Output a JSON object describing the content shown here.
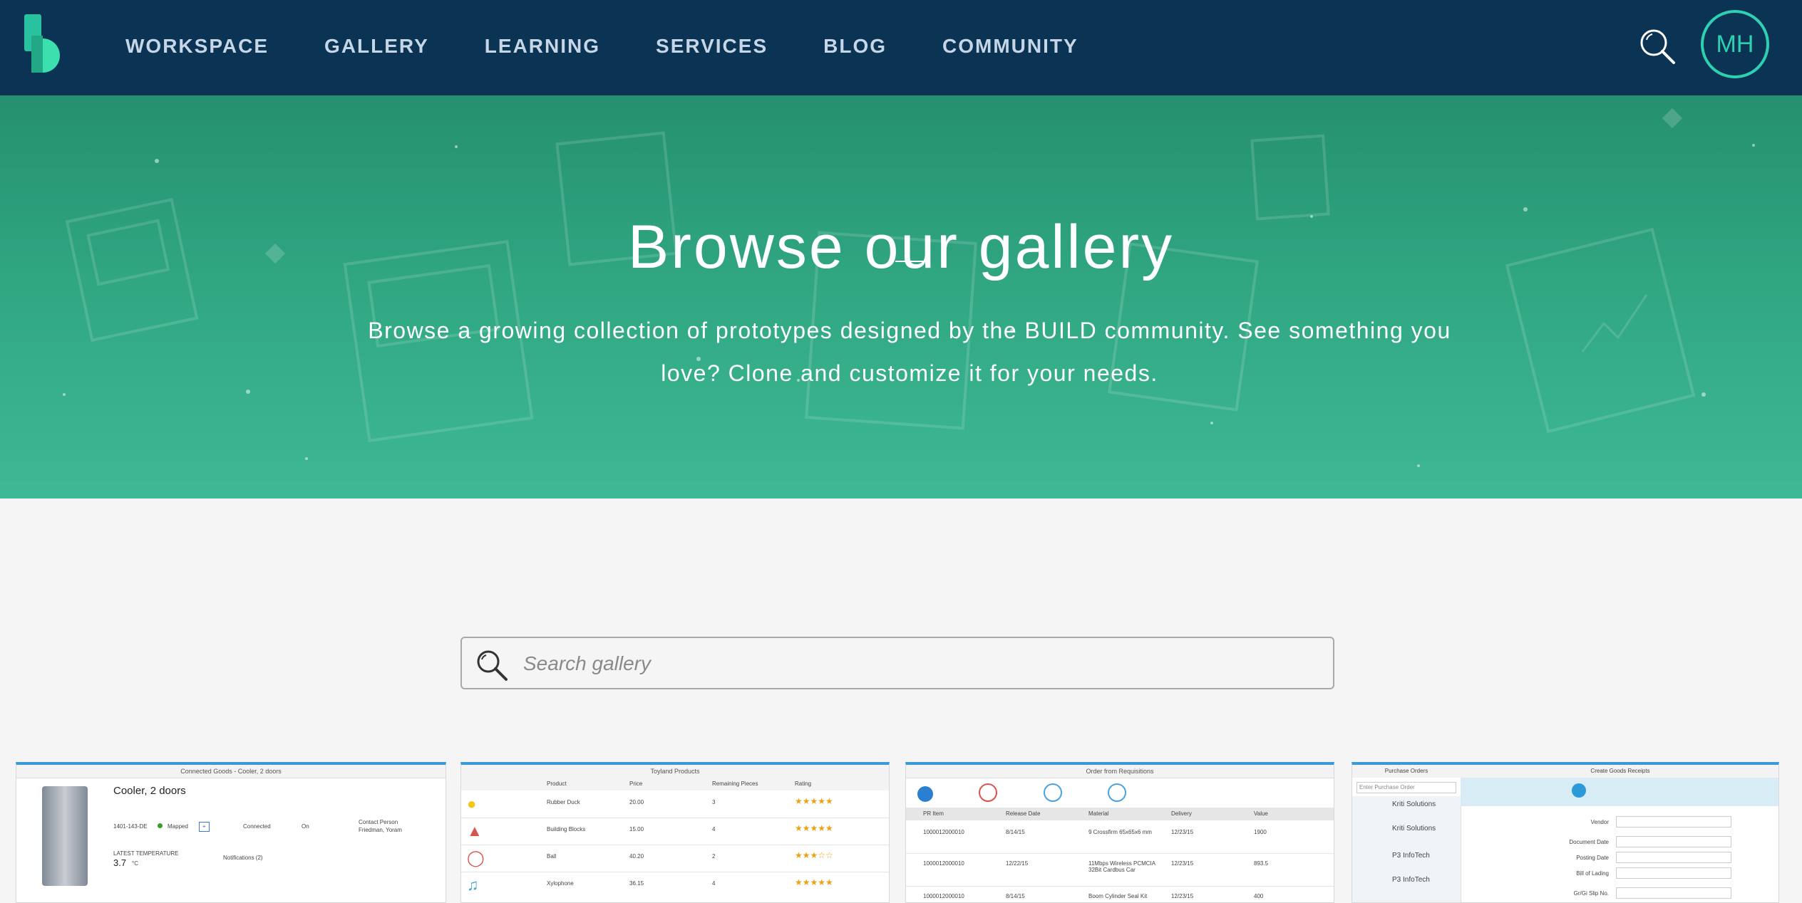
{
  "nav": {
    "items": [
      "WORKSPACE",
      "GALLERY",
      "LEARNING",
      "SERVICES",
      "BLOG",
      "COMMUNITY"
    ],
    "avatar_initials": "MH"
  },
  "hero": {
    "title": "Browse our gallery",
    "description": "Browse a growing collection of prototypes designed by the BUILD community. See something you love? Clone and customize it for your needs."
  },
  "search": {
    "placeholder": "Search gallery"
  },
  "cards": [
    {
      "caption": "Connected Goods - Cooler, 2 doors",
      "title": "Cooler, 2 doors",
      "id": "1401-143-DE",
      "status": "Mapped",
      "connected": "Connected",
      "power": "On",
      "contact_label": "Contact Person",
      "contact_name": "Friedman, Yoram",
      "temp_label": "LATEST TEMPERATURE",
      "temp_value": "3.7",
      "temp_unit": "°C",
      "notifications": "Notifications (2)"
    },
    {
      "caption": "Toyland Products",
      "headers": [
        "Product",
        "Price",
        "Remaining Pieces",
        "Rating"
      ],
      "rows": [
        [
          "Rubber Duck",
          "20.00",
          "3"
        ],
        [
          "Building Blocks",
          "15.00",
          "4"
        ],
        [
          "Ball",
          "40.20",
          "2"
        ],
        [
          "Xylophone",
          "36.15",
          "4"
        ]
      ]
    },
    {
      "caption": "Order from Requisitions",
      "headers": [
        "PR Item",
        "Release Date",
        "Material",
        "Delivery",
        "Value"
      ],
      "rows": [
        [
          "1000012000010",
          "8/14/15",
          "9 Crossfirm 65x65x6 mm",
          "12/23/15",
          "1900"
        ],
        [
          "1000012000010",
          "12/22/15",
          "11Mbps Wireless PCMCIA 32Bit Cardbus Car",
          "12/23/15",
          "893.5"
        ],
        [
          "1000012000010",
          "8/14/15",
          "Boom Cylinder Seal Kit",
          "12/23/15",
          "400"
        ]
      ]
    },
    {
      "caption_left": "Purchase Orders",
      "caption_right": "Create Goods Receipts",
      "search_placeholder": "Enter Purchase Order",
      "list": [
        "Kriti Solutions",
        "Kriti Solutions",
        "P3 InfoTech",
        "P3 InfoTech"
      ],
      "fields": [
        "Vendor",
        "Document Date",
        "Posting Date",
        "Bill of Lading",
        "Gr/Gi Slip No."
      ]
    }
  ]
}
